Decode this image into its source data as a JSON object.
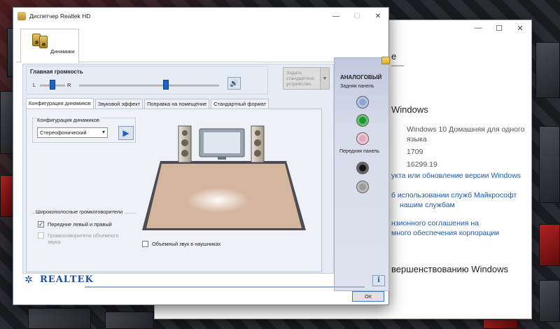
{
  "window": {
    "title": "Диспетчер Realtek HD",
    "minimize": "—",
    "maximize": "☐",
    "close": "✕"
  },
  "device_tab": {
    "label": "Динамики"
  },
  "volume": {
    "label": "Главная громкость",
    "left": "L",
    "right": "R",
    "balance_fraction": 0.5,
    "level_fraction": 0.62
  },
  "default_device_button": {
    "label": "Задать стандартное устройство"
  },
  "tabs": [
    {
      "label": "Конфигурация динамиков",
      "active": true
    },
    {
      "label": "Звуковой эффект",
      "active": false
    },
    {
      "label": "Поправка на помещение",
      "active": false
    },
    {
      "label": "Стандартный формат",
      "active": false
    }
  ],
  "speaker_config": {
    "group_label": "Конфигурация динамиков",
    "selected": "Стереофонический"
  },
  "wideband": {
    "group_label": "Широкополосные громкоговорители",
    "front_lr": {
      "label": "Передние левый и правый",
      "checked": true,
      "enabled": true
    },
    "surround": {
      "label": "Громкоговорители объемного звука",
      "checked": false,
      "enabled": false
    }
  },
  "headphones": {
    "label": "Объемный звук в наушниках",
    "checked": false
  },
  "analog": {
    "title": "АНАЛОГОВЫЙ",
    "back_panel": "Задняя панель",
    "front_panel": "Передняя панель",
    "back_jacks": [
      "#8fa6d6",
      "#1c9a2c",
      "#e2a8bd"
    ],
    "front_jacks": [
      "#151515",
      "#9a9a9a"
    ]
  },
  "footer": {
    "logo": "REALTEK",
    "info": "i",
    "ok": "ОК"
  },
  "background_window": {
    "partial_lines": [
      "е",
      "Windows",
      "Windows 10 Домашняя для одного",
      "языка",
      "1709",
      "16299.19",
      "укта или обновление версии Windows",
      "б использовании служб Майкрософт",
      "нашим службам",
      "нзионного соглашения на",
      "много обеспечения корпорации",
      "вершенствованию Windows"
    ]
  }
}
